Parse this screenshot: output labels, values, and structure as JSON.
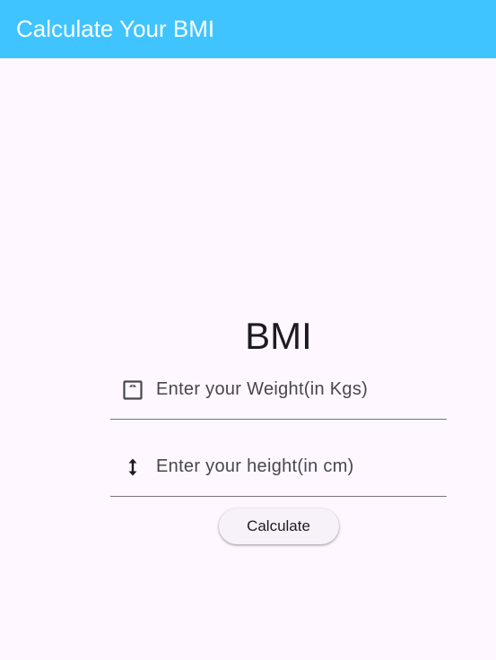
{
  "app_bar": {
    "title": "Calculate Your BMI",
    "background_color": "#40c4ff"
  },
  "main": {
    "heading": "BMI",
    "weight_field": {
      "placeholder": "Enter your Weight(in Kgs)",
      "value": "",
      "icon": "scale-icon"
    },
    "height_field": {
      "placeholder": "Enter your height(in cm)",
      "value": "",
      "icon": "height-arrow-icon"
    },
    "calculate_button": {
      "label": "Calculate"
    }
  }
}
